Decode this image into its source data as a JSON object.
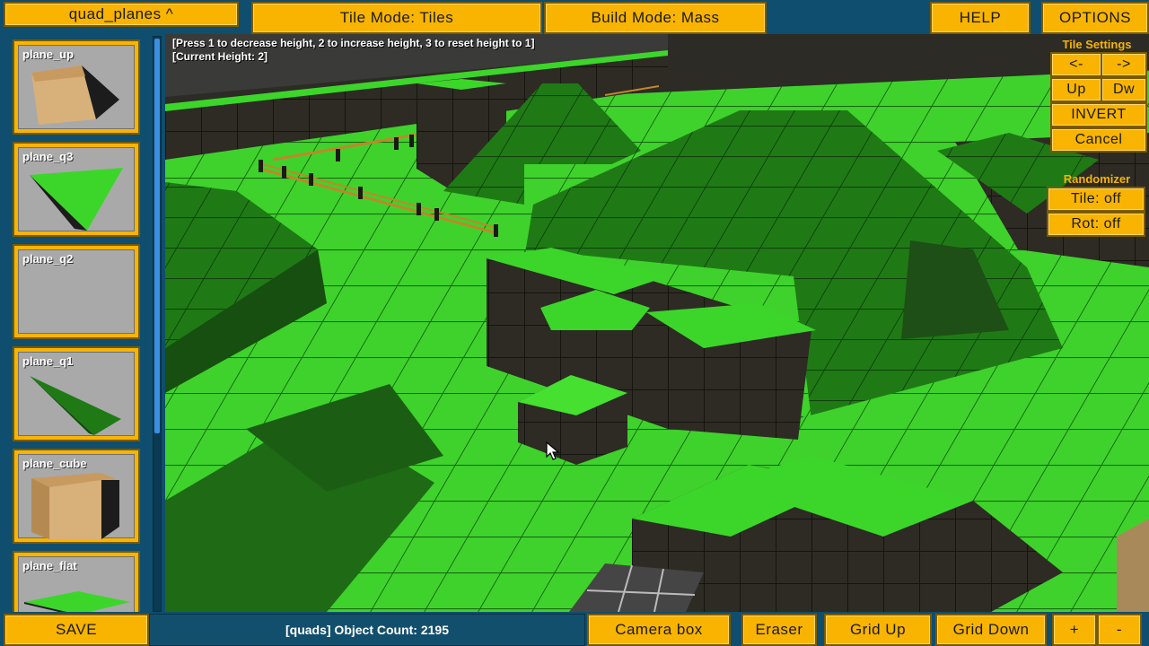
{
  "topbar": {
    "tileset_selector": "quad_planes ^",
    "tile_mode": "Tile Mode: Tiles",
    "build_mode": "Build Mode: Mass",
    "help": "HELP",
    "options": "OPTIONS"
  },
  "tile_settings": {
    "title": "Tile Settings",
    "prev": "<-",
    "next": "->",
    "up": "Up",
    "down": "Dw",
    "invert": "INVERT",
    "cancel": "Cancel"
  },
  "randomizer": {
    "title": "Randomizer",
    "tile": "Tile: off",
    "rot": "Rot: off"
  },
  "viewport": {
    "hint_line1": "[Press 1 to decrease height, 2 to increase height, 3 to reset height to 1]",
    "hint_line2": "[Current Height: 2]"
  },
  "tiles": [
    {
      "label": "plane_up",
      "icon": "ramp-icon"
    },
    {
      "label": "plane_q3",
      "icon": "triangle-q3-icon"
    },
    {
      "label": "plane_q2",
      "icon": "empty-icon"
    },
    {
      "label": "plane_q1",
      "icon": "triangle-q1-icon"
    },
    {
      "label": "plane_cube",
      "icon": "cube-icon"
    },
    {
      "label": "plane_flat",
      "icon": "flat-plane-icon"
    }
  ],
  "bottombar": {
    "save": "SAVE",
    "status": "[quads] Object Count: 2195",
    "camera_box": "Camera box",
    "eraser": "Eraser",
    "grid_up": "Grid Up",
    "grid_down": "Grid Down",
    "plus": "+",
    "minus": "-"
  },
  "colors": {
    "button": "#f8b400",
    "background": "#0f4e6e",
    "grass": "#3cd62a",
    "wall": "#2c2a23"
  }
}
